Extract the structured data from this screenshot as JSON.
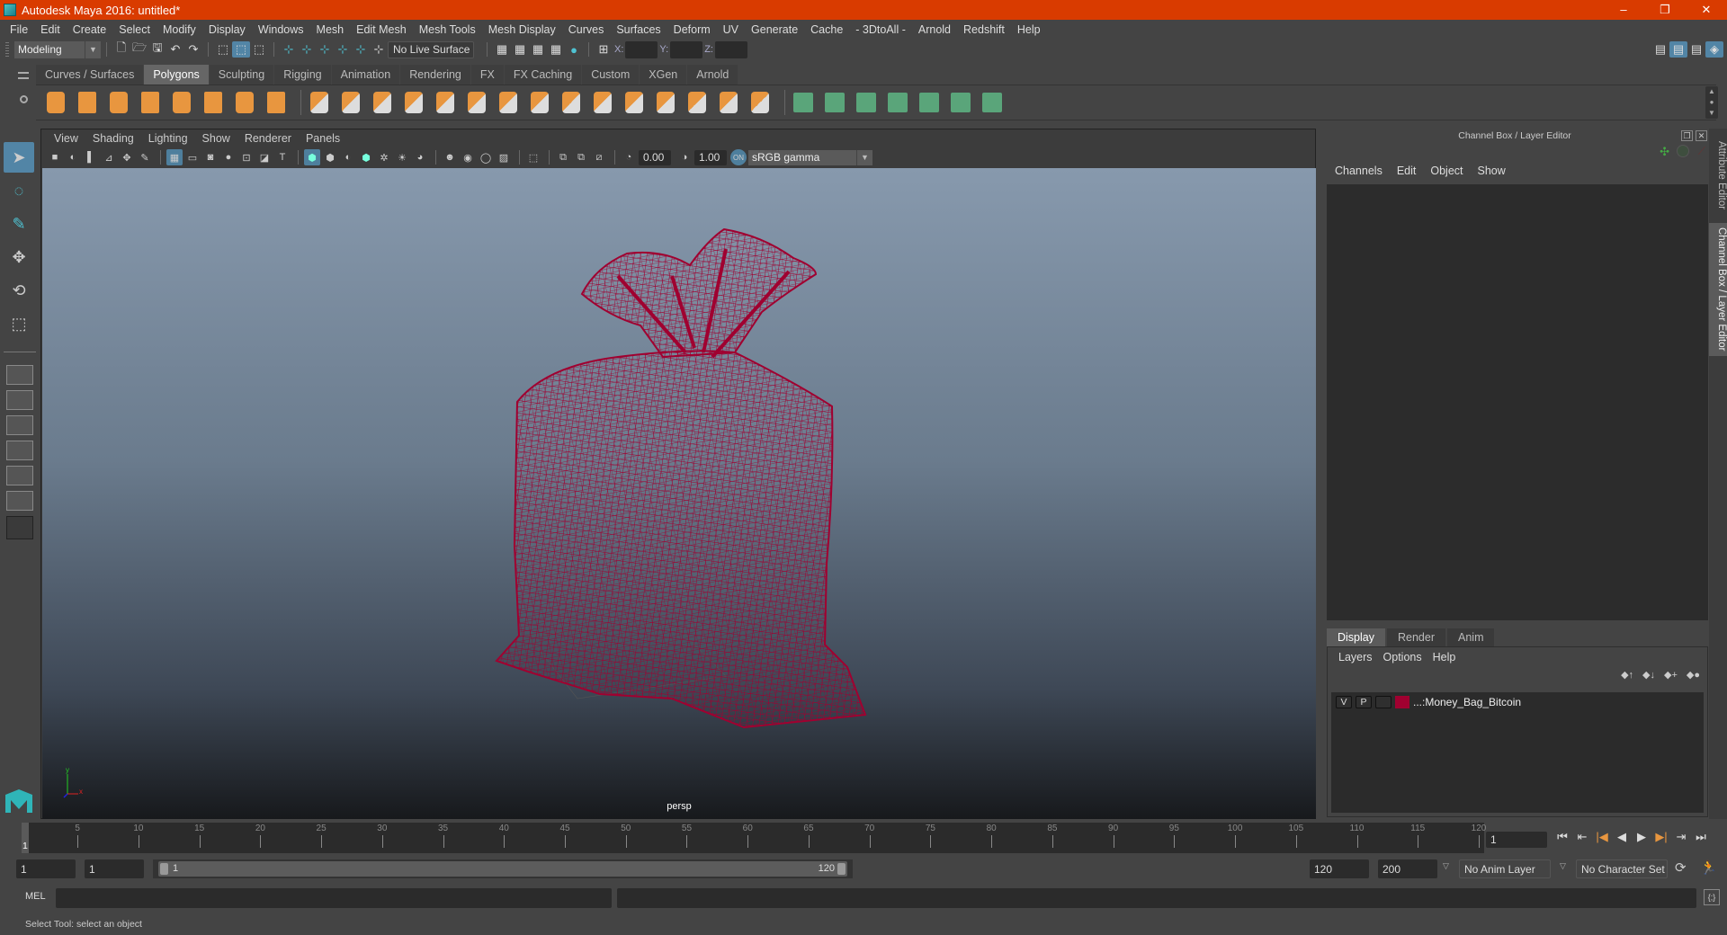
{
  "window": {
    "title": "Autodesk Maya 2016: untitled*",
    "controls": [
      "–",
      "❐",
      "✕"
    ]
  },
  "menubar": [
    "File",
    "Edit",
    "Create",
    "Select",
    "Modify",
    "Display",
    "Windows",
    "Mesh",
    "Edit Mesh",
    "Mesh Tools",
    "Mesh Display",
    "Curves",
    "Surfaces",
    "Deform",
    "UV",
    "Generate",
    "Cache",
    "- 3DtoAll -",
    "Arnold",
    "Redshift",
    "Help"
  ],
  "statusline": {
    "mode": "Modeling",
    "live_surface": "No Live Surface",
    "x_label": "X:",
    "y_label": "Y:",
    "z_label": "Z:",
    "x_value": "",
    "y_value": "",
    "z_value": ""
  },
  "shelf": {
    "tabs": [
      "Curves / Surfaces",
      "Polygons",
      "Sculpting",
      "Rigging",
      "Animation",
      "Rendering",
      "FX",
      "FX Caching",
      "Custom",
      "XGen",
      "Arnold"
    ],
    "active_tab": "Polygons",
    "icons": [
      "poly-sphere",
      "poly-cube",
      "poly-cylinder",
      "poly-cone",
      "poly-plane",
      "poly-torus",
      "poly-pyramid",
      "poly-pipe",
      "combine",
      "separate",
      "mirror",
      "smooth",
      "extract",
      "bevel",
      "bridge",
      "extrude",
      "multi-cut",
      "target-weld",
      "fill-hole",
      "insert-edge-loop",
      "offset-edge-loop",
      "append-polygon",
      "quad-draw",
      "planar-uv",
      "automatic-uv",
      "cylindrical-uv",
      "spherical-uv",
      "unfold-uv",
      "uv-editor",
      "uv-layout"
    ]
  },
  "viewport": {
    "menu": [
      "View",
      "Shading",
      "Lighting",
      "Show",
      "Renderer",
      "Panels"
    ],
    "exposure": "0.00",
    "gamma": "1.00",
    "color_space": "sRGB gamma",
    "camera_label": "persp",
    "mesh_color": "#a00030"
  },
  "channel_box": {
    "title": "Channel Box / Layer Editor",
    "menu": [
      "Channels",
      "Edit",
      "Object",
      "Show"
    ]
  },
  "layer_editor": {
    "tabs": [
      "Display",
      "Render",
      "Anim"
    ],
    "active_tab": "Display",
    "menu": [
      "Layers",
      "Options",
      "Help"
    ],
    "layers": [
      {
        "v": "V",
        "p": "P",
        "color": "#a00030",
        "name": "...:Money_Bag_Bitcoin"
      }
    ]
  },
  "side_tabs": [
    "Attribute Editor",
    "Channel Box / Layer Editor"
  ],
  "timeline": {
    "ticks": [
      "5",
      "10",
      "15",
      "20",
      "25",
      "30",
      "35",
      "40",
      "45",
      "50",
      "55",
      "60",
      "65",
      "70",
      "75",
      "80",
      "85",
      "90",
      "95",
      "100",
      "105",
      "110",
      "115",
      "120"
    ],
    "current_frame": "1",
    "current_frame_field": "1",
    "playback": [
      "⏮",
      "⇤",
      "|◀",
      "◀",
      "▶",
      "▶|",
      "⇥",
      "⏭"
    ]
  },
  "range": {
    "start": "1",
    "anim_start": "1",
    "slider_start": "1",
    "slider_end": "120",
    "end": "120",
    "anim_end": "200",
    "anim_layer": "No Anim Layer",
    "character_set": "No Character Set"
  },
  "command_line": {
    "label": "MEL",
    "input": "",
    "result": ""
  },
  "status": {
    "help_text": "Select Tool: select an object"
  }
}
